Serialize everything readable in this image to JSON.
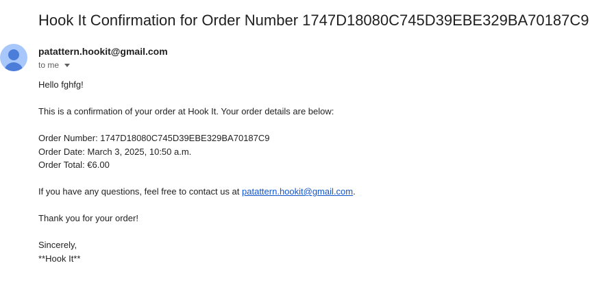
{
  "email": {
    "subject": "Hook It Confirmation for Order Number 1747D18080C745D39EBE329BA70187C9",
    "sender": "patattern.hookit@gmail.com",
    "recipient_label": "to me",
    "avatar_icon": "person-icon",
    "greeting": "Hello fghfg!",
    "intro": "This is a confirmation of your order at Hook It. Your order details are below:",
    "order_number_line": "Order Number: 1747D18080C745D39EBE329BA70187C9",
    "order_date_line": "Order Date: March 3, 2025, 10:50 a.m.",
    "order_total_line": "Order Total: €6.00",
    "questions_prefix": "If you have any questions, feel free to contact us at ",
    "contact_email": "patattern.hookit@gmail.com",
    "questions_suffix": ".",
    "thanks": "Thank you for your order!",
    "closing": "Sincerely,",
    "signature": "**Hook It**"
  }
}
